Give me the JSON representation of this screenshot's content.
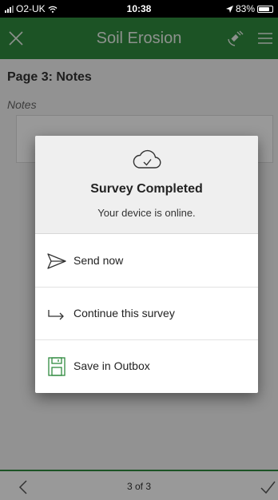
{
  "status_bar": {
    "carrier": "O2-UK",
    "time": "10:38",
    "battery": "83%"
  },
  "header": {
    "title": "Soil Erosion",
    "close_icon": "close-icon",
    "gps_icon": "gps-satellite-icon",
    "menu_icon": "hamburger-menu-icon"
  },
  "page": {
    "title": "Page 3: Notes",
    "field_label": "Notes"
  },
  "dialog": {
    "title": "Survey Completed",
    "subtitle": "Your device is online.",
    "options": [
      {
        "label": "Send now",
        "icon": "send-icon"
      },
      {
        "label": "Continue this survey",
        "icon": "continue-arrow-icon"
      },
      {
        "label": "Save in Outbox",
        "icon": "save-icon"
      }
    ]
  },
  "footer": {
    "page_indicator": "3 of 3"
  },
  "colors": {
    "brand_green": "#2f8a3f"
  }
}
